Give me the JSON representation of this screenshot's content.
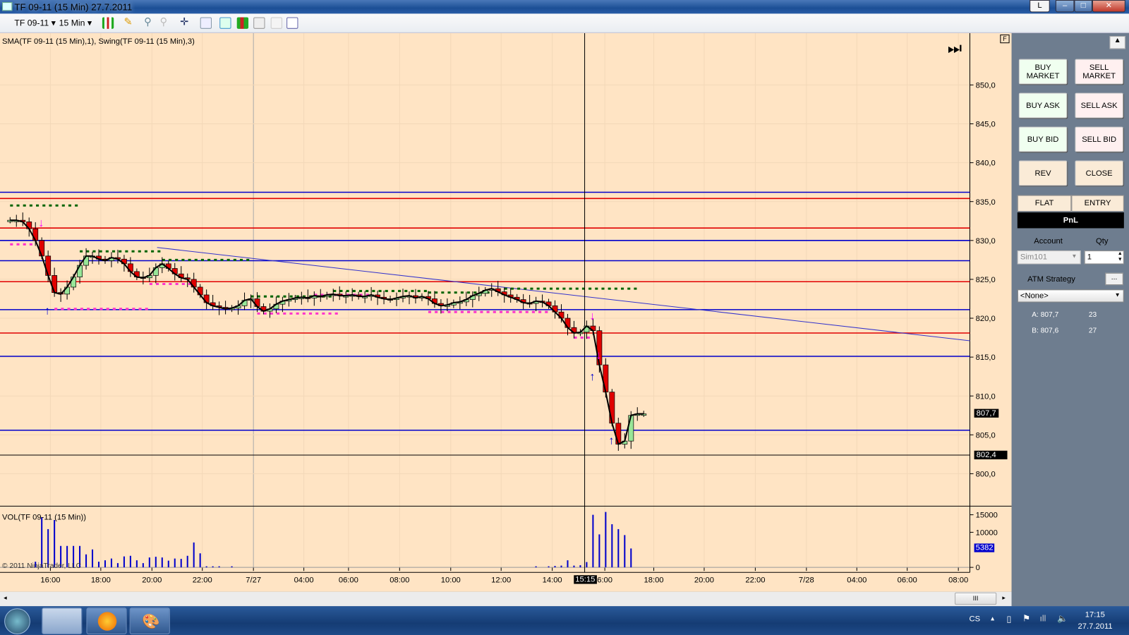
{
  "window": {
    "title": "TF 09-11 (15 Min)  27.7.2011",
    "btn_l": "L",
    "btn_min": "–",
    "btn_max": "□",
    "btn_close": "✕"
  },
  "toolbar": {
    "instrument": "TF 09-11",
    "interval": "15 Min"
  },
  "chart": {
    "indicator_label": "SMA(TF 09-11 (15 Min),1), Swing(TF 09-11 (15 Min),3)",
    "volume_label": "VOL(TF 09-11 (15 Min))",
    "copyright": "© 2011 NinjaTrader, LLC",
    "f_button": "F",
    "crosshair_time": "15:15",
    "last_price": "807,7",
    "marker_price": "802,4",
    "last_volume": "5382",
    "price_ticks": [
      "850,0",
      "845,0",
      "840,0",
      "835,0",
      "830,0",
      "825,0",
      "820,0",
      "815,0",
      "810,0",
      "805,0",
      "800,0"
    ],
    "volume_ticks": [
      "15000",
      "10000",
      "0"
    ],
    "time_ticks": [
      "16:00",
      "18:00",
      "20:00",
      "22:00",
      "7/27",
      "04:00",
      "06:00",
      "08:00",
      "10:00",
      "12:00",
      "14:00",
      "6:00",
      "18:00",
      "20:00",
      "22:00",
      "7/28",
      "04:00",
      "06:00",
      "08:00"
    ]
  },
  "chart_data": {
    "type": "candlestick",
    "ylim": [
      798,
      852
    ],
    "closes": [
      832.6,
      832.6,
      832.4,
      831.5,
      830,
      828,
      825.5,
      823.3,
      823.1,
      824,
      825.3,
      826.8,
      828,
      828,
      827.6,
      827.4,
      827.8,
      827.6,
      827,
      826,
      825.3,
      825.2,
      825.5,
      826.5,
      827,
      826.4,
      825.7,
      825.2,
      825,
      824,
      823,
      822,
      821.6,
      821.4,
      821.2,
      821.3,
      821.6,
      822.3,
      822.5,
      821.5,
      820.9,
      821.2,
      821.8,
      822.2,
      822.4,
      822.6,
      822.7,
      822.6,
      822.9,
      822.8,
      823,
      823.1,
      822.9,
      822.9,
      823,
      822.8,
      822.8,
      823,
      822.7,
      822.5,
      822.4,
      822.6,
      822.8,
      822.9,
      822.6,
      822.8,
      822.5,
      821.9,
      821.6,
      821.7,
      822,
      822.1,
      822.4,
      822.9,
      823.2,
      823.6,
      823.8,
      823.4,
      823,
      822.7,
      822.4,
      822,
      821.9,
      822.2,
      822.1,
      821.6,
      820.8,
      820,
      818.8,
      818.1,
      818.2,
      819,
      818.4,
      814,
      810.5,
      806.5,
      803.8,
      804.2,
      807.5,
      807.7,
      807.7
    ],
    "volumes": [
      0,
      0,
      0,
      0,
      1600,
      14300,
      10900,
      13500,
      6100,
      6100,
      6100,
      6100,
      3700,
      5100,
      1600,
      2000,
      2500,
      1200,
      3100,
      3300,
      2000,
      1200,
      2800,
      3000,
      2800,
      1900,
      2500,
      2400,
      3300,
      7100,
      4000,
      300,
      300,
      300,
      0,
      300,
      0,
      0,
      0,
      0,
      0,
      0,
      0,
      0,
      0,
      0,
      0,
      0,
      0,
      0,
      0,
      0,
      0,
      0,
      0,
      0,
      0,
      0,
      0,
      0,
      0,
      0,
      0,
      0,
      0,
      0,
      0,
      0,
      0,
      0,
      0,
      0,
      0,
      0,
      0,
      0,
      0,
      0,
      0,
      0,
      0,
      0,
      0,
      300,
      0,
      300,
      400,
      500,
      2000,
      500,
      600,
      1500,
      15000,
      9400,
      15800,
      12300,
      10900,
      9200,
      5382,
      0,
      0
    ],
    "horizontal_lines": [
      {
        "price": 836.2,
        "color": "#0000cc"
      },
      {
        "price": 835.4,
        "color": "#e00000"
      },
      {
        "price": 831.6,
        "color": "#e00000"
      },
      {
        "price": 830.0,
        "color": "#0000cc"
      },
      {
        "price": 827.4,
        "color": "#0000cc"
      },
      {
        "price": 824.7,
        "color": "#e00000"
      },
      {
        "price": 821.1,
        "color": "#0000cc"
      },
      {
        "price": 818.1,
        "color": "#e00000"
      },
      {
        "price": 815.1,
        "color": "#0000cc"
      },
      {
        "price": 805.6,
        "color": "#0000cc"
      },
      {
        "price": 802.4,
        "color": "#000000"
      }
    ],
    "trend_line": {
      "from": [
        23.2,
        829.1
      ],
      "to": [
        151.5,
        817.1
      ],
      "color": "#3333cc"
    },
    "swing_highs": [
      {
        "from": 0,
        "to": 11,
        "price": 834.5
      },
      {
        "from": 11,
        "to": 24,
        "price": 828.6
      },
      {
        "from": 24,
        "to": 38,
        "price": 827.5
      },
      {
        "from": 38,
        "to": 51,
        "price": 822.8
      },
      {
        "from": 51,
        "to": 66,
        "price": 823.5
      },
      {
        "from": 66,
        "to": 76,
        "price": 823.3
      },
      {
        "from": 78,
        "to": 99,
        "price": 823.8
      }
    ],
    "swing_lows": [
      {
        "from": 0,
        "to": 4,
        "price": 829.5
      },
      {
        "from": 7,
        "to": 22,
        "price": 821.2
      },
      {
        "from": 22,
        "to": 29,
        "price": 824.4
      },
      {
        "from": 39,
        "to": 52,
        "price": 820.6
      },
      {
        "from": 48,
        "to": 57,
        "price": 823.0
      },
      {
        "from": 66,
        "to": 85,
        "price": 820.8
      },
      {
        "from": 89,
        "to": 92,
        "price": 817.5
      }
    ],
    "arrows_down": [
      {
        "i": 5,
        "price": 831.8
      },
      {
        "i": 92,
        "price": 819.8
      },
      {
        "i": 93,
        "price": 814.8
      }
    ],
    "arrows_up": [
      {
        "i": 6,
        "price": 820.5
      },
      {
        "i": 92,
        "price": 812.0
      },
      {
        "i": 95,
        "price": 803.8
      }
    ],
    "colors": {
      "up": "#98e698",
      "down": "#e00000",
      "swing_high": "#006400",
      "swing_low": "#ff33cc",
      "sma": "#000000"
    }
  },
  "panel": {
    "buy_market": "BUY MARKET",
    "sell_market": "SELL MARKET",
    "buy_ask": "BUY ASK",
    "sell_ask": "SELL ASK",
    "buy_bid": "BUY BID",
    "sell_bid": "SELL BID",
    "rev": "REV",
    "close": "CLOSE",
    "flat": "FLAT",
    "entry": "ENTRY",
    "pnl": "PnL",
    "account_label": "Account",
    "qty_label": "Qty",
    "account": "Sim101",
    "qty": "1",
    "atm_label": "ATM Strategy",
    "atm_btn": "...",
    "atm_value": "<None>",
    "ask": "A: 807,7",
    "ask_size": "23",
    "bid": "B: 807,6",
    "bid_size": "27"
  },
  "taskbar": {
    "lang": "CS",
    "time": "17:15",
    "date": "27.7.2011"
  }
}
